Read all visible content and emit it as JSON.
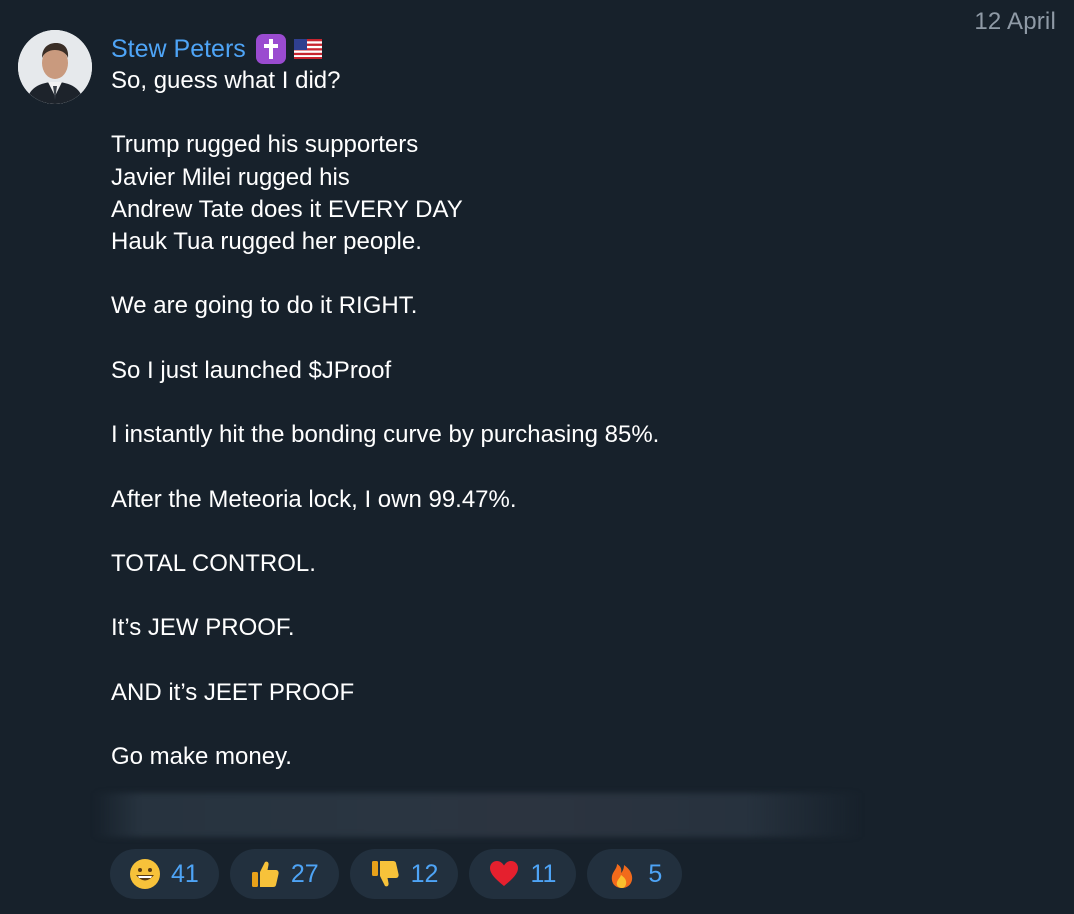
{
  "date": "12 April",
  "sender": {
    "name": "Stew Peters",
    "badges": [
      "cross-icon",
      "us-flag-icon"
    ]
  },
  "message": {
    "lines": [
      "So, guess what I did?",
      "",
      "Trump rugged his supporters",
      "Javier Milei rugged his",
      "Andrew Tate does it EVERY DAY",
      "Hauk Tua rugged her people.",
      "",
      "We are going to do it RIGHT.",
      "",
      "So I just launched $JProof",
      "",
      "I instantly hit the bonding curve by purchasing 85%.",
      "",
      "After the Meteoria lock, I own 99.47%.",
      "",
      "TOTAL CONTROL.",
      "",
      "It’s JEW PROOF.",
      "",
      "AND it’s JEET PROOF",
      "",
      "Go make money."
    ]
  },
  "reactions": [
    {
      "icon": "grinning-face-icon",
      "count": "41"
    },
    {
      "icon": "thumbs-up-icon",
      "count": "27"
    },
    {
      "icon": "thumbs-down-icon",
      "count": "12"
    },
    {
      "icon": "red-heart-icon",
      "count": "11"
    },
    {
      "icon": "fire-icon",
      "count": "5"
    }
  ],
  "colors": {
    "background": "#17212b",
    "accent": "#4ea4f6",
    "reaction_bg": "#22303e",
    "date": "#8f9aa6"
  }
}
